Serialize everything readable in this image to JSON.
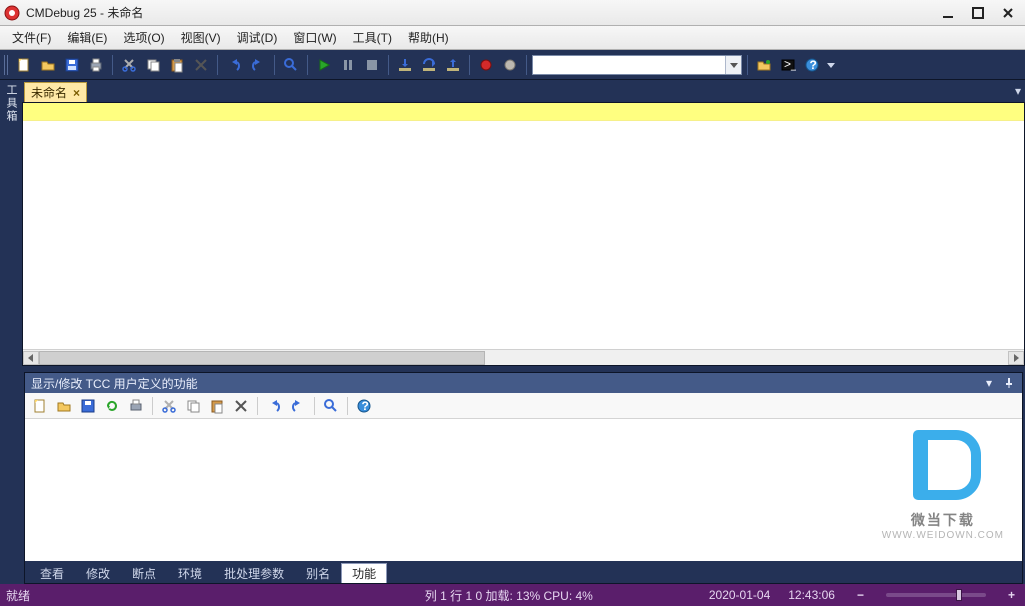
{
  "title": "CMDebug 25 - 未命名",
  "menus": [
    "文件(F)",
    "编辑(E)",
    "选项(O)",
    "视图(V)",
    "调试(D)",
    "窗口(W)",
    "工具(T)",
    "帮助(H)"
  ],
  "sidebar_label": "工具箱",
  "tab_label": "未命名",
  "panel_title": "显示/修改 TCC 用户定义的功能",
  "panel_tabs": [
    "查看",
    "修改",
    "断点",
    "环境",
    "批处理参数",
    "别名",
    "功能"
  ],
  "panel_active_index": 6,
  "status": {
    "ready": "就绪",
    "pos": "列 1  行 1   0   加载:  13%      CPU:   4%",
    "date": "2020-01-04",
    "time": "12:43:06"
  },
  "watermark": {
    "brand": "微当下载",
    "url": "WWW.WEIDOWN.COM"
  }
}
